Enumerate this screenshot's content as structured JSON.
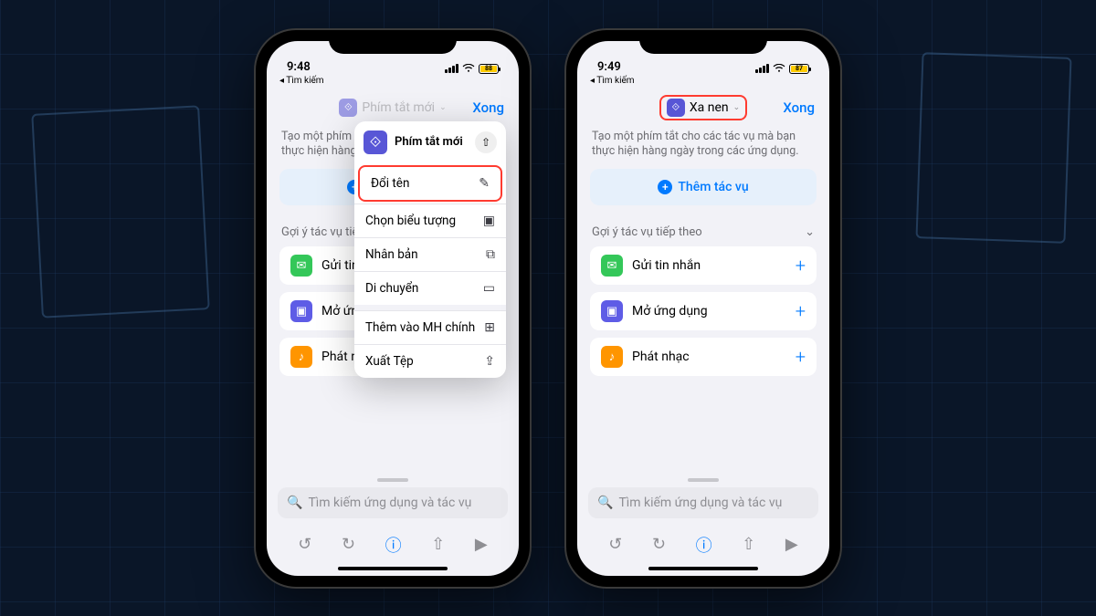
{
  "status": {
    "time_left": "9:48",
    "time_right": "9:49",
    "back_search": "◂ Tìm kiếm",
    "battery_left": "88",
    "battery_right": "87"
  },
  "nav": {
    "done": "Xong",
    "title_left": "Phím tắt mới",
    "title_right": "Xa nen"
  },
  "desc": {
    "left": "Tạo một phím tắt cho các tác vụ mà bạn thực hiện hàng ngày trong các ứng dụng.",
    "right": "Tạo một phím tắt cho các tác vụ mà bạn thực hiện hàng ngày trong các ứng dụng."
  },
  "add_action": "Thêm tác vụ",
  "section": "Gợi ý tác vụ tiếp theo",
  "suggestions": [
    {
      "label": "Gửi tin nhắn",
      "color": "ic-green",
      "glyph": "✉"
    },
    {
      "label": "Mở ứng dụng",
      "color": "ic-purple",
      "glyph": "▣"
    },
    {
      "label": "Phát nhạc",
      "color": "ic-orange",
      "glyph": "♪"
    }
  ],
  "search_placeholder": "Tìm kiếm ứng dụng và tác vụ",
  "popover": {
    "header": "Phím tắt mới",
    "items": [
      {
        "label": "Đổi tên",
        "icon": "✎",
        "hl": true
      },
      {
        "label": "Chọn biểu tượng",
        "icon": "▣"
      },
      {
        "label": "Nhân bản",
        "icon": "⧉"
      },
      {
        "label": "Di chuyển",
        "icon": "▭"
      }
    ],
    "items2": [
      {
        "label": "Thêm vào MH chính",
        "icon": "⊞"
      },
      {
        "label": "Xuất Tệp",
        "icon": "⇪"
      }
    ]
  }
}
